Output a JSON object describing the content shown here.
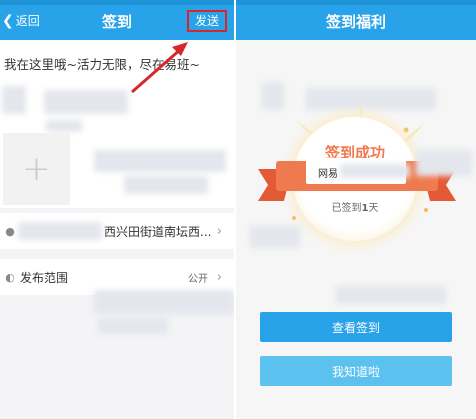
{
  "left_screen": {
    "header": {
      "back_icon": "chevron-left-icon",
      "back_label": "返回",
      "title": "签到",
      "send_label": "发送"
    },
    "post_text": "我在这里哦~活力无限，尽在易班~",
    "location": {
      "icon": "map-pin-icon",
      "text": "西兴田街道南坛西..."
    },
    "scope": {
      "icon": "globe-icon",
      "label": "发布范围",
      "value": "公开"
    },
    "colors": {
      "header": "#28a2e8",
      "highlight_box": "#d8262a",
      "arrow": "#d8262a"
    }
  },
  "right_screen": {
    "header": {
      "title": "签到福利"
    },
    "card": {
      "success_text": "签到成功",
      "prefix_text": "网易",
      "checked_prefix": "已签到",
      "checked_days": "1",
      "checked_suffix": "天"
    },
    "buttons": {
      "view_label": "查看签到",
      "know_label": "我知道啦"
    },
    "colors": {
      "primary": "#28a2e8",
      "secondary": "#5bc1ee",
      "ribbon": "#f07a4f"
    }
  }
}
